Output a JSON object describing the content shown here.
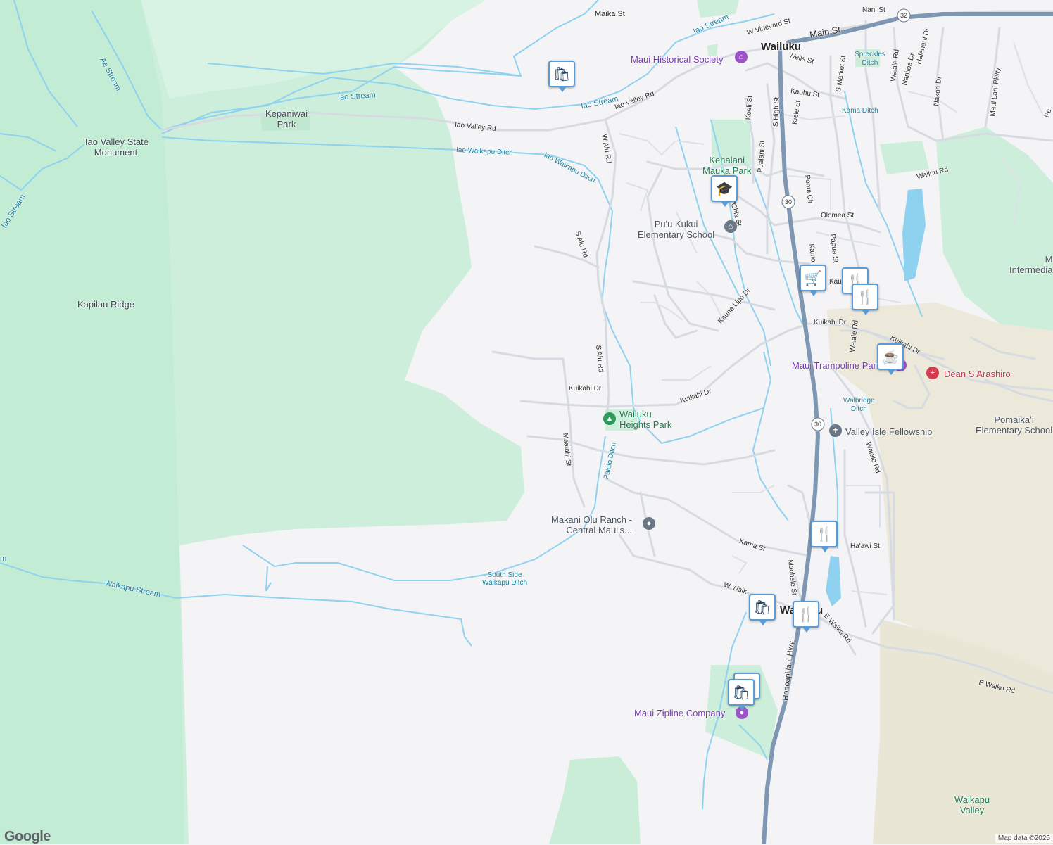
{
  "map": {
    "labels": {
      "wailuku": "Wailuku",
      "waikapu": "Waikapu",
      "kapilau_ridge": "Kapilau Ridge",
      "iao_valley_monument": "ʻIao Valley State\nMonument",
      "kepaniwai_park": "Kepaniwai\nPark",
      "kehalani_mauka_park": "Kehalani\nMauka Park",
      "puu_kukui_school": "Pu'u Kukui\nElementary School",
      "wailuku_heights_park": "Wailuku\nHeights Park",
      "maui_historical_society": "Maui Historical Society",
      "maui_trampoline_park": "Maui Trampoline Park",
      "dean_arashiro": "Dean S Arashiro",
      "valley_isle_fellowship": "Valley Isle Fellowship",
      "makani_olu_ranch": "Makani Olu Ranch -\nCentral Maui's...",
      "maui_zipline": "Maui Zipline Company",
      "pomaikai_school": "Pōmaikaʻi\nElementary School",
      "intermediate": "M\nIntermedia",
      "waikapu_valley": "Waikapu\nValley",
      "spreckles_ditch": "Spreckles\nDitch",
      "kama_ditch": "Kama Ditch",
      "walbridge_ditch": "Walbridge\nDitch"
    },
    "streets": {
      "maika_st": "Maika St",
      "w_vineyard_st": "W Vineyard St",
      "main_st": "Main St",
      "nani_st": "Nani St",
      "wells_st": "Wells St",
      "s_market_st": "S Market St",
      "kiele_st": "Kiele St",
      "kaohu_st": "Kaohu St",
      "koeli_st": "Koeli St",
      "s_high_st": "S High St",
      "pualani_st": "Pualani St",
      "iao_valley_rd_1": "Iao Valley Rd",
      "iao_valley_rd_2": "Iao Valley Rd",
      "w_alu_rd": "W Alu Rd",
      "s_alu_rd_1": "S Alu Rd",
      "s_alu_rd_2": "S Alu Rd",
      "komo_ohia_st": "Komo 'Ohia St",
      "ponui_cir": "Ponui Cir",
      "olomea_st": "Olomea St",
      "papua_st": "Papua St",
      "kamo": "Kamo",
      "kau": "Kau",
      "kauna_lipo_dr": "Kauna Lipo Dr",
      "kuikahi_dr_1": "Kuikahi Dr",
      "kuikahi_dr_2": "Kuikahi Dr",
      "kuikahi_dr_3": "Kuikahi Dr",
      "kuikahi_dr_4": "Kuikahi Dr",
      "waiale_rd_1": "Waiale Rd",
      "waiale_rd_2": "Waiale Rd",
      "waiale_rd_3": "Waiale Rd",
      "maalahi_st": "Maalahi St",
      "kama_st": "Kama St",
      "haawi_st": "Ha'awi St",
      "moohele_st": "Moohele St",
      "w_waik": "W Waik",
      "e_waiko_rd_1": "E Waiko Rd",
      "e_waiko_rd_2": "E Waiko Rd",
      "honoapiilani_hwy": "Honoapiilani Hwy",
      "waiinu_rd": "Waiinu Rd",
      "nakoa_dr": "Nakoa Dr",
      "maui_lani_pkwy": "Maui Lani Pkwy",
      "nanea_dr": "Naniloa Dr",
      "halenani_dr": "Halenani Dr",
      "pe": "Pe"
    },
    "waterways": {
      "ae_stream": "Ae Stream",
      "iao_stream_1": "Iao Stream",
      "iao_stream_2": "Iao Stream",
      "iao_stream_3": "Iao Stream",
      "iao_stream_4": "Iao Stream",
      "iao_waikapu_ditch_1": "Iao Waikapu Ditch",
      "iao_waikapu_ditch_2": "Iao Waikapu Ditch",
      "paiolo_ditch": "Paiolo Ditch",
      "south_side_ditch": "South Side\nWaikapu Ditch",
      "waikapu_stream": "Waikapu Stream",
      "stream_edge": "m"
    },
    "route_shields": [
      "32",
      "30",
      "30"
    ]
  },
  "footer": {
    "google_logo": "Google",
    "attribution": "Map data ©2025"
  },
  "colors": {
    "background": "#f4f3f5",
    "park_green": "#cdeedb",
    "park_green_dark": "#bfe8cf",
    "water": "#8fd2ef",
    "highway": "#7f97b3",
    "road": "#d6dbe2",
    "sand": "#ece8da",
    "pin_border": "#5b9bd5"
  }
}
